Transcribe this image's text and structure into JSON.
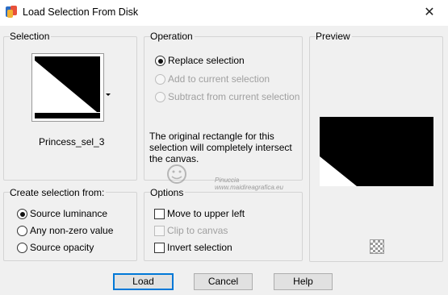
{
  "window": {
    "title": "Load Selection From Disk",
    "close_glyph": "✕"
  },
  "selection": {
    "group_label": "Selection",
    "file_name": "Princess_sel_3"
  },
  "operation": {
    "group_label": "Operation",
    "options": [
      {
        "label": "Replace selection",
        "checked": true,
        "enabled": true
      },
      {
        "label": "Add to current selection",
        "checked": false,
        "enabled": false
      },
      {
        "label": "Subtract from current selection",
        "checked": false,
        "enabled": false
      }
    ],
    "note": [
      "The original rectangle for this",
      "selection will completely intersect",
      "the canvas."
    ]
  },
  "preview": {
    "group_label": "Preview"
  },
  "create_from": {
    "group_label": "Create selection from:",
    "options": [
      {
        "label": "Source luminance",
        "checked": true
      },
      {
        "label": "Any non-zero value",
        "checked": false
      },
      {
        "label": "Source opacity",
        "checked": false
      }
    ]
  },
  "options": {
    "group_label": "Options",
    "items": [
      {
        "label": "Move to upper left",
        "checked": false,
        "enabled": true
      },
      {
        "label": "Clip to canvas",
        "checked": false,
        "enabled": false
      },
      {
        "label": "Invert selection",
        "checked": false,
        "enabled": true
      }
    ]
  },
  "watermark": {
    "line1": "Pinuccia",
    "line2": "www.maidireagrafica.eu"
  },
  "buttons": {
    "load": "Load",
    "cancel": "Cancel",
    "help": "Help"
  },
  "colors": {
    "default_button_border": "#0078d7",
    "dialog_bg": "#f0f0f0"
  },
  "icons": [
    "app-icon",
    "close-icon",
    "dropdown-arrow-icon",
    "transparency-checker-icon"
  ]
}
